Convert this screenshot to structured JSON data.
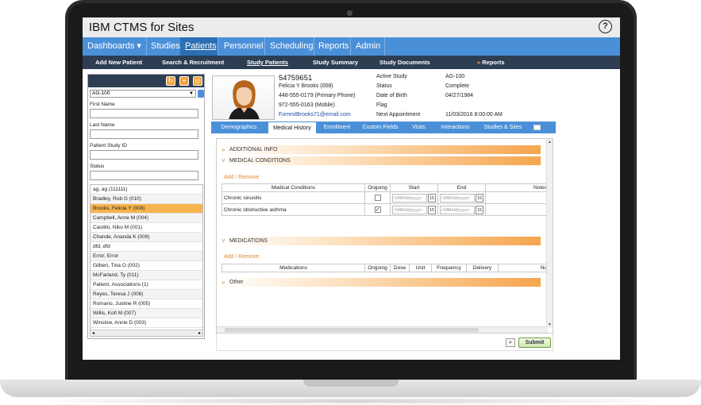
{
  "app": {
    "title": "IBM CTMS for Sites",
    "help_icon": "?"
  },
  "main_nav": [
    {
      "label": "Dashboards",
      "chevron": "▾"
    },
    {
      "label": "Studies"
    },
    {
      "label": "Patients"
    },
    {
      "label": "Personnel"
    },
    {
      "label": "Scheduling"
    },
    {
      "label": "Reports"
    },
    {
      "label": "Admin"
    }
  ],
  "sub_nav": [
    {
      "label": "Add New Patient"
    },
    {
      "label": "Search & Recruitment"
    },
    {
      "label": "Study Patients"
    },
    {
      "label": "Study Summary"
    },
    {
      "label": "Study Documents"
    },
    {
      "label": "Reports",
      "prefix": "»"
    }
  ],
  "left_panel": {
    "study_select": "AG-100",
    "fields": [
      {
        "label": "First Name",
        "value": ""
      },
      {
        "label": "Last Name",
        "value": ""
      },
      {
        "label": "Patient Study ID",
        "value": ""
      },
      {
        "label": "Status",
        "value": ""
      }
    ],
    "patients": [
      "ag, ag (111111)",
      "Bradley, Rob G (010)",
      "Brooks, Felicia Y (008)",
      "Campbell, Anne M (004)",
      "Castillo, Niko M (001)",
      "Chande, Ananda K (009)",
      "dfd, dfd",
      "Error, Error",
      "Gilbert, Tina O (002)",
      "McFarland, Ty (011)",
      "Patient, Associations (1)",
      "Reyes, Teresa J (006)",
      "Romano, Justine R (005)",
      "Willis, Kofi M (007)",
      "Winslow, Annie D (003)"
    ],
    "selected_index": 2
  },
  "patient": {
    "id": "54759651",
    "name": "Felicia Y Brooks (008)",
    "primary_phone": "448-555-0179 (Primary Phone)",
    "mobile_phone": "972-555-0163 (Mobile)",
    "email": "ForrestBrooks71@email.com",
    "details": [
      {
        "key": "Active Study",
        "value": "AG-100"
      },
      {
        "key": "Status",
        "value": "Complete"
      },
      {
        "key": "Date of Birth",
        "value": "04/27/1984"
      },
      {
        "key": "Flag",
        "value": ""
      },
      {
        "key": "Next Appointment",
        "value": "11/03/2016 8:00:00 AM"
      }
    ]
  },
  "tabs": [
    {
      "label": "Demographics"
    },
    {
      "label": "Medical History"
    },
    {
      "label": "Enrollment"
    },
    {
      "label": "Custom Fields"
    },
    {
      "label": "Visits"
    },
    {
      "label": "Interactions"
    },
    {
      "label": "Studies & Sites"
    }
  ],
  "active_tab_index": 1,
  "sections": {
    "additional_info": "ADDITIONAL INFO",
    "medical_conditions": "MEDICAL CONDITIONS",
    "medications": "MEDICATIONS",
    "other": "Other",
    "add_remove": "Add / Remove"
  },
  "conditions_table": {
    "headers": [
      "Medical Conditions",
      "Ongoing",
      "Start",
      "End",
      "Notes"
    ],
    "rows": [
      {
        "condition": "Chronic sinusitis",
        "ongoing": false,
        "start_placeholder": "<MM/dd/yyyy>",
        "end_placeholder": "<MM/dd/yyyy>",
        "notes": ""
      },
      {
        "condition": "Chronic obstructive asthma",
        "ongoing": true,
        "start_placeholder": "<MM/dd/yyyy>",
        "end_placeholder": "<MM/dd/yyyy>",
        "notes": ""
      }
    ],
    "calendar_label": "15"
  },
  "medications_table": {
    "headers": [
      "Medications",
      "Ongoing",
      "Dose",
      "Unit",
      "Frequency",
      "Delivery",
      "No"
    ]
  },
  "footer": {
    "submit_label": "Submit"
  },
  "colors": {
    "nav_blue": "#4a90d9",
    "subnav_dark": "#2d3e53",
    "accent_orange": "#f5a54d",
    "selected_row": "#f7b44e"
  }
}
